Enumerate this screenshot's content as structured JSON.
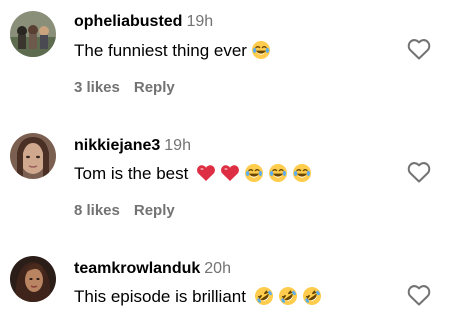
{
  "comments": [
    {
      "username": "opheliabusted",
      "time": "19h",
      "text": "The funniest thing ever",
      "emojis": [
        "tears-of-joy-emoji"
      ],
      "likes": "3 likes",
      "reply_label": "Reply"
    },
    {
      "username": "nikkiejane3",
      "time": "19h",
      "text": "Tom is the best",
      "emojis": [
        "red-heart-emoji",
        "red-heart-emoji",
        "tears-of-joy-emoji",
        "tears-of-joy-emoji",
        "tears-of-joy-emoji"
      ],
      "likes": "8 likes",
      "reply_label": "Reply"
    },
    {
      "username": "teamkrowlanduk",
      "time": "20h",
      "text": "This episode is brilliant",
      "emojis": [
        "rolling-on-floor-laughing-emoji",
        "rolling-on-floor-laughing-emoji",
        "rolling-on-floor-laughing-emoji"
      ],
      "likes": "",
      "reply_label": ""
    }
  ],
  "icons": {
    "like": "heart-outline-icon"
  },
  "colors": {
    "secondary_text": "#737373",
    "emoji_face": "#FFCC4D",
    "heart_red": "#DD2E44"
  }
}
